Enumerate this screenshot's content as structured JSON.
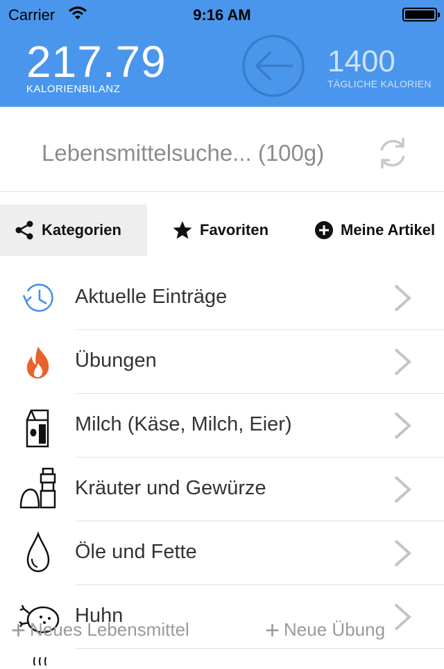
{
  "status": {
    "carrier": "Carrier",
    "time": "9:16 AM"
  },
  "header": {
    "balance_value": "217.79",
    "balance_label": "KALORIENBILANZ",
    "daily_value": "1400",
    "daily_label": "TÄGLICHE KALORIEN"
  },
  "search": {
    "text": "Lebensmittelsuche... (100g)"
  },
  "tabs": [
    {
      "label": "Kategorien",
      "active": true
    },
    {
      "label": "Favoriten"
    },
    {
      "label": "Meine Artikel"
    }
  ],
  "rows": [
    {
      "label": "Aktuelle Einträge",
      "icon": "clock-history-icon"
    },
    {
      "label": "Übungen",
      "icon": "flame-icon"
    },
    {
      "label": "Milch (Käse, Milch, Eier)",
      "icon": "milk-carton-icon"
    },
    {
      "label": "Kräuter und Gewürze",
      "icon": "pepper-grinder-icon"
    },
    {
      "label": "Öle und Fette",
      "icon": "oil-drop-icon"
    },
    {
      "label": "Huhn",
      "icon": "chicken-icon"
    }
  ],
  "bottom": {
    "new_food": "Neues Lebensmittel",
    "new_exercise": "Neue Übung"
  },
  "colors": {
    "header": "#4a96ec",
    "clock": "#3b8de6",
    "flame": "#e8632a"
  }
}
